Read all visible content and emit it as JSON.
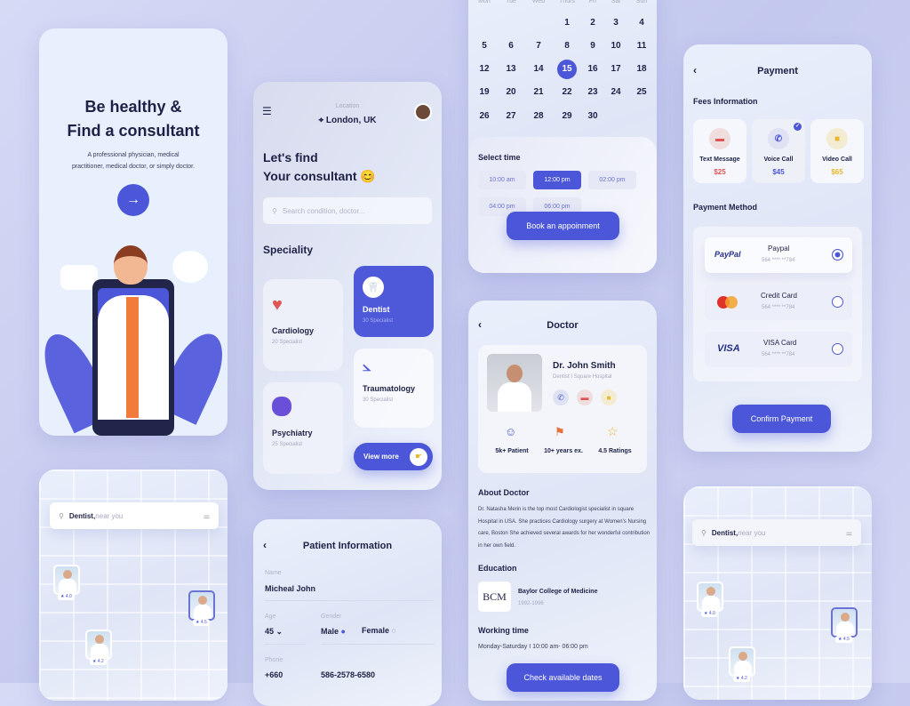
{
  "colors": {
    "accent": "#4b56d8",
    "background": "#c9cdf0",
    "red": "#e05454",
    "yellow": "#e8b82a"
  },
  "onboarding": {
    "title1": "Be healthy &",
    "title2": "Find a consultant",
    "subtitle": "A professional physician, medical practitioner, medical doctor, or simply doctor.",
    "next_icon": "arrow-right-icon"
  },
  "map": {
    "search_bold": "Dentist,",
    "search_rest": " near you",
    "pins": [
      {
        "rating": "★ 4.0"
      },
      {
        "rating": "★ 4.5"
      },
      {
        "rating": "★ 4.2"
      }
    ]
  },
  "home": {
    "location_label": "Location",
    "location": "⌖ London, UK",
    "greeting1": "Let's find",
    "greeting2": "Your consultant 😊",
    "search_placeholder": "Search condition, doctor...",
    "speciality_title": "Speciality",
    "specialities": [
      {
        "name": "Cardiology",
        "count": "20 Specialist"
      },
      {
        "name": "Dentist",
        "count": "30 Specialist"
      },
      {
        "name": "Traumatology",
        "count": "30 Specialist"
      },
      {
        "name": "Psychiatry",
        "count": "25 Specialist"
      }
    ],
    "view_more": "View more"
  },
  "patient": {
    "title": "Patient Information",
    "name_label": "Name",
    "name": "Micheal John",
    "age_label": "Age",
    "age": "45 ⌄",
    "gender_label": "Gender",
    "male": "Male",
    "female": "Female",
    "selected_gender": "Male",
    "phone_label": "Phone",
    "phone_code": "+660",
    "phone": "586-2578-6580"
  },
  "calendar": {
    "weekdays": [
      "Mon",
      "Tue",
      "Wed",
      "Thurs",
      "Fri",
      "Sat",
      "Sun"
    ],
    "first_weekday_index": 3,
    "days_in_month": 30,
    "selected_day": 15,
    "select_time": "Select time",
    "slots": [
      "10:00 am",
      "12:00 pm",
      "02:00 pm",
      "04:00 pm",
      "06:00 pm"
    ],
    "selected_slot": "12:00 pm",
    "book": "Book an appoinment"
  },
  "doctor": {
    "title": "Doctor",
    "name": "Dr. John Smith",
    "role": "Dentist I Square Hospital",
    "stats": [
      {
        "label": "5k+ Patient"
      },
      {
        "label": "10+ years ex."
      },
      {
        "label": "4.5 Ratings"
      }
    ],
    "about_title": "About Doctor",
    "about": "Dr. Natasha Merin is the top most Cardiologist specialist in square Hospital in USA. She practices Cardiology surgery at Women's Nursing care, Boston She achieved several awards for her wonderful contribution in her own field.",
    "education_title": "Education",
    "school_logo": "BCM",
    "school": "Baylor College of Medicine",
    "years": "1992-1996",
    "working_title": "Working time",
    "working": "Monday-Saturday I 10:00 am- 06:00 pm",
    "check": "Check available dates"
  },
  "payment": {
    "title": "Payment",
    "fees_title": "Fees Information",
    "fees": [
      {
        "label": "Text Message",
        "price": "$25"
      },
      {
        "label": "Voice Call",
        "price": "$45",
        "selected": true
      },
      {
        "label": "Video Call",
        "price": "$65"
      }
    ],
    "method_title": "Payment Method",
    "methods": [
      {
        "logo": "PayPal",
        "name": "Paypal",
        "number": "564 **** **784",
        "selected": true
      },
      {
        "logo": "mastercard",
        "name": "Credit Card",
        "number": "564 **** **784"
      },
      {
        "logo": "VISA",
        "name": "VISA Card",
        "number": "564 **** **784"
      }
    ],
    "confirm": "Confirm Payment"
  }
}
